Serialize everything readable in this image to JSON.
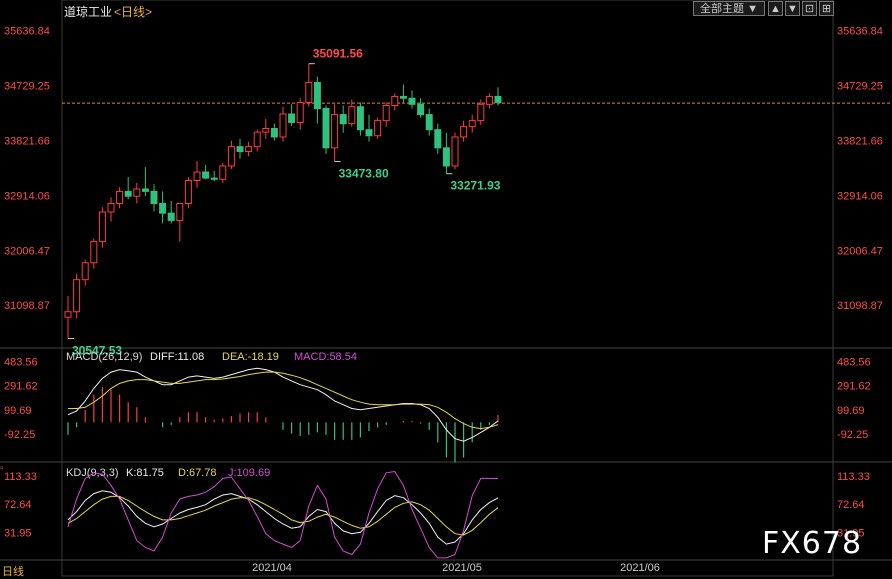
{
  "header": {
    "title": "道琼工业",
    "period": "<日线>",
    "theme_label": "全部主题 ▼",
    "buttons": [
      "▲",
      "▼",
      "⊡",
      "⊞"
    ]
  },
  "watermark": "FX678",
  "corner_label": "日线",
  "colors": {
    "up": "#ff3b3b",
    "down": "#2ec27e",
    "bg": "#000000"
  },
  "chart_data": {
    "type": "candlestick",
    "price_axis": {
      "ticks": [
        "35636.84",
        "34729.25",
        "33821.66",
        "32914.06",
        "32006.47",
        "31098.87"
      ],
      "ylim": [
        30440,
        35880
      ]
    },
    "reference_line": 34440,
    "x_axis_labels": [
      "2021/04",
      "2021/05",
      "2021/06"
    ],
    "annotations": [
      {
        "text": "35091.56",
        "bar": 28,
        "kind": "high",
        "color": "#ff4a4a"
      },
      {
        "text": "30547.53",
        "bar": 0,
        "kind": "low",
        "color": "#3fcf8e"
      },
      {
        "text": "33473.80",
        "bar": 31,
        "kind": "low",
        "color": "#3fcf8e"
      },
      {
        "text": "33271.93",
        "bar": 44,
        "kind": "low",
        "color": "#3fcf8e"
      }
    ],
    "ohlc": [
      [
        30900,
        31250,
        30547.53,
        30990
      ],
      [
        30990,
        31620,
        30880,
        31520
      ],
      [
        31520,
        31850,
        31420,
        31800
      ],
      [
        31800,
        32200,
        31700,
        32150
      ],
      [
        32150,
        32720,
        32050,
        32640
      ],
      [
        32640,
        32880,
        32480,
        32780
      ],
      [
        32780,
        33050,
        32700,
        32980
      ],
      [
        32980,
        33220,
        32850,
        32900
      ],
      [
        32900,
        33120,
        32780,
        33020
      ],
      [
        33020,
        33380,
        32900,
        32980
      ],
      [
        32980,
        33100,
        32650,
        32780
      ],
      [
        32780,
        32980,
        32450,
        32620
      ],
      [
        32620,
        32820,
        32450,
        32500
      ],
      [
        32500,
        32780,
        32150,
        32780
      ],
      [
        32780,
        33220,
        32700,
        33160
      ],
      [
        33160,
        33480,
        33040,
        33300
      ],
      [
        33300,
        33420,
        33180,
        33200
      ],
      [
        33200,
        33320,
        33150,
        33180
      ],
      [
        33180,
        33450,
        33120,
        33400
      ],
      [
        33400,
        33820,
        33350,
        33720
      ],
      [
        33720,
        33850,
        33520,
        33640
      ],
      [
        33640,
        33800,
        33560,
        33720
      ],
      [
        33720,
        34000,
        33640,
        33960
      ],
      [
        33960,
        34180,
        33850,
        34020
      ],
      [
        34020,
        34100,
        33820,
        33880
      ],
      [
        33880,
        34380,
        33800,
        34260
      ],
      [
        34260,
        34420,
        34060,
        34120
      ],
      [
        34120,
        34520,
        34000,
        34450
      ],
      [
        34450,
        35091.56,
        34380,
        34780
      ],
      [
        34780,
        34880,
        34100,
        34350
      ],
      [
        34350,
        34400,
        33600,
        33700
      ],
      [
        33700,
        34420,
        33473.8,
        34250
      ],
      [
        34250,
        34400,
        33950,
        34100
      ],
      [
        34100,
        34500,
        34050,
        34380
      ],
      [
        34380,
        34450,
        33900,
        34000
      ],
      [
        34000,
        34250,
        33800,
        33900
      ],
      [
        33900,
        34200,
        33850,
        34150
      ],
      [
        34150,
        34450,
        34050,
        34400
      ],
      [
        34400,
        34600,
        34320,
        34550
      ],
      [
        34550,
        34750,
        34450,
        34520
      ],
      [
        34520,
        34650,
        34350,
        34420
      ],
      [
        34420,
        34520,
        34200,
        34250
      ],
      [
        34250,
        34350,
        33900,
        34000
      ],
      [
        34000,
        34100,
        33600,
        33700
      ],
      [
        33700,
        33950,
        33271.93,
        33400
      ],
      [
        33400,
        33950,
        33350,
        33880
      ],
      [
        33880,
        34150,
        33800,
        34050
      ],
      [
        34050,
        34250,
        33950,
        34150
      ],
      [
        34150,
        34500,
        34080,
        34420
      ],
      [
        34420,
        34600,
        34350,
        34550
      ],
      [
        34550,
        34700,
        34400,
        34450
      ]
    ],
    "macd": {
      "label": "MACD(26,12,9)",
      "diff_label": "DIFF:11.08",
      "dea_label": "DEA:-18.19",
      "macd_label": "MACD:58.54",
      "ticks": [
        "483.56",
        "291.62",
        "99.69",
        "-92.25"
      ],
      "ylim": [
        -300,
        560
      ],
      "diff": [
        60,
        90,
        170,
        270,
        350,
        400,
        420,
        410,
        400,
        360,
        330,
        300,
        300,
        330,
        360,
        370,
        360,
        350,
        360,
        380,
        400,
        420,
        430,
        420,
        400,
        360,
        330,
        300,
        280,
        260,
        220,
        170,
        140,
        110,
        100,
        110,
        120,
        130,
        140,
        150,
        150,
        140,
        110,
        40,
        -60,
        -130,
        -150,
        -120,
        -80,
        -40,
        11.08
      ],
      "dea": [
        110,
        110,
        120,
        160,
        210,
        270,
        310,
        330,
        340,
        340,
        330,
        320,
        310,
        310,
        320,
        330,
        340,
        340,
        345,
        355,
        365,
        380,
        390,
        400,
        400,
        390,
        375,
        355,
        330,
        300,
        270,
        240,
        210,
        180,
        160,
        145,
        140,
        140,
        140,
        145,
        145,
        145,
        140,
        120,
        80,
        30,
        -10,
        -40,
        -50,
        -40,
        -18.19
      ],
      "hist": [
        -100,
        -40,
        100,
        220,
        280,
        260,
        220,
        160,
        120,
        40,
        0,
        -40,
        -20,
        40,
        80,
        80,
        40,
        20,
        30,
        50,
        70,
        80,
        80,
        40,
        0,
        -60,
        -90,
        -110,
        -100,
        -80,
        -100,
        -140,
        -140,
        -140,
        -120,
        -70,
        -40,
        -20,
        0,
        10,
        10,
        -10,
        -60,
        -160,
        -280,
        -320,
        -280,
        -160,
        -60,
        -20,
        58.54
      ]
    },
    "kdj": {
      "label": "KDJ(9,3,3)",
      "k_label": "K:81.75",
      "d_label": "D:67.78",
      "j_label": "J:109.69",
      "ticks": [
        "113.33",
        "72.64",
        "31.95"
      ],
      "ylim": [
        -8,
        125
      ],
      "k": [
        50,
        62,
        78,
        88,
        92,
        90,
        82,
        70,
        55,
        45,
        40,
        44,
        52,
        60,
        65,
        68,
        72,
        80,
        86,
        88,
        84,
        80,
        72,
        62,
        52,
        44,
        38,
        40,
        55,
        65,
        62,
        45,
        34,
        30,
        32,
        45,
        62,
        78,
        85,
        82,
        72,
        60,
        45,
        25,
        15,
        18,
        30,
        50,
        65,
        75,
        81.75
      ],
      "d": [
        45,
        52,
        62,
        72,
        80,
        84,
        84,
        78,
        70,
        62,
        55,
        50,
        50,
        52,
        56,
        60,
        64,
        70,
        75,
        80,
        82,
        82,
        78,
        72,
        65,
        58,
        50,
        46,
        48,
        54,
        58,
        54,
        48,
        42,
        38,
        40,
        48,
        58,
        68,
        74,
        76,
        72,
        64,
        52,
        40,
        30,
        28,
        35,
        46,
        58,
        67.78
      ],
      "j": [
        40,
        80,
        110,
        118,
        116,
        100,
        80,
        50,
        20,
        10,
        5,
        25,
        60,
        80,
        84,
        86,
        90,
        98,
        110,
        112,
        95,
        78,
        55,
        30,
        20,
        15,
        10,
        20,
        70,
        100,
        80,
        25,
        5,
        0,
        15,
        60,
        95,
        118,
        120,
        100,
        65,
        38,
        10,
        -5,
        -5,
        0,
        35,
        85,
        110,
        110,
        109.69
      ]
    }
  }
}
